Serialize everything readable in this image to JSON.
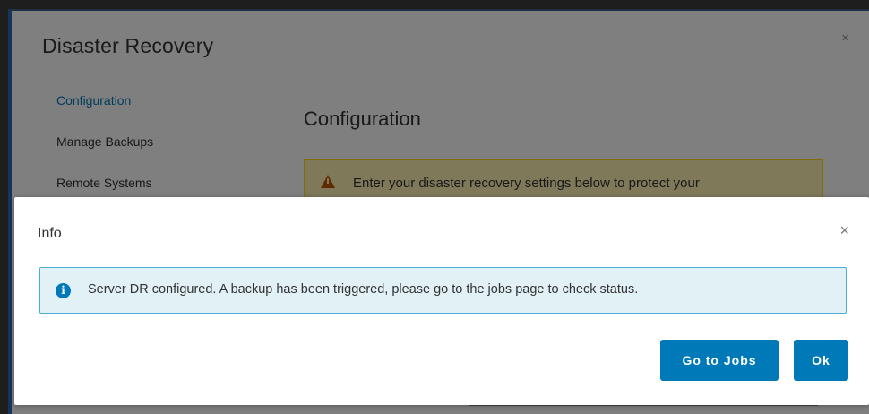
{
  "background_modal": {
    "title": "Disaster Recovery",
    "close_glyph": "×",
    "nav": [
      {
        "label": "Configuration",
        "active": true
      },
      {
        "label": "Manage Backups",
        "active": false
      },
      {
        "label": "Remote Systems",
        "active": false
      }
    ],
    "heading": "Configuration",
    "alert_text": "Enter your disaster recovery settings below to protect your",
    "alert_icon": "warning-icon"
  },
  "info_modal": {
    "title": "Info",
    "close_glyph": "×",
    "alert_icon": "info-icon",
    "alert_text": "Server DR configured. A backup has been triggered, please go to the jobs page to check status.",
    "buttons": {
      "go_to_jobs": "Go to Jobs",
      "ok": "Ok"
    }
  },
  "colors": {
    "primary": "#0079b8",
    "info_bg": "#e1f1f6",
    "info_border": "#49afd9",
    "warning_bg": "#fef3b5",
    "warning_border": "#ffdc0b"
  }
}
